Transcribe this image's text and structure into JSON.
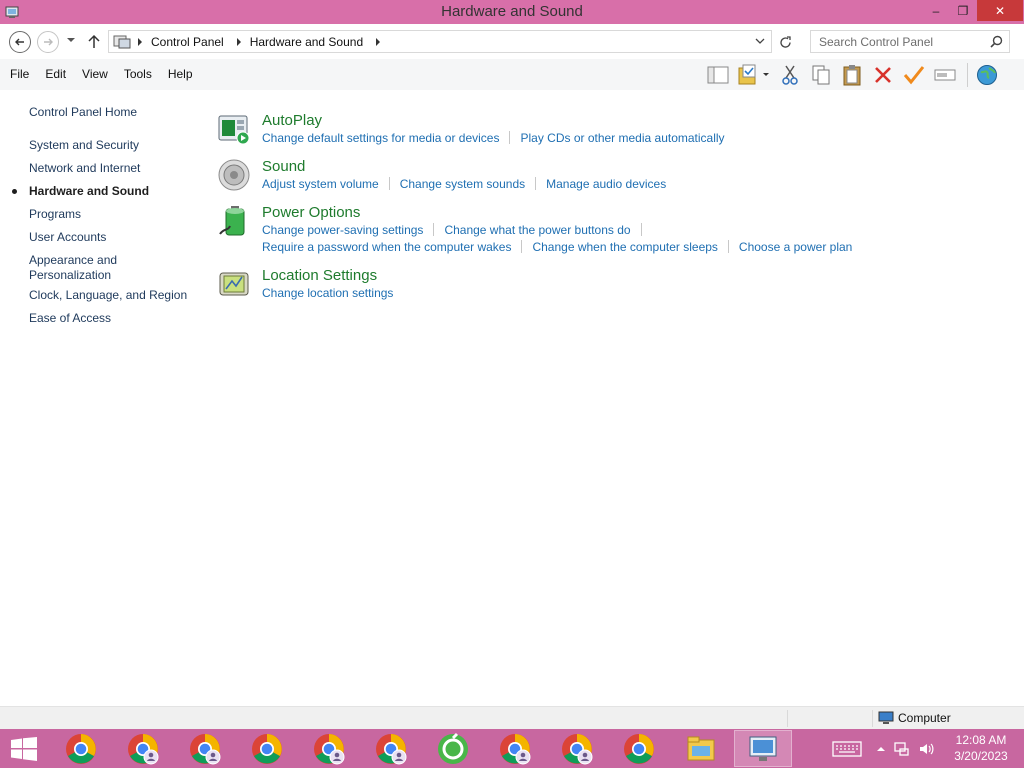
{
  "window": {
    "title": "Hardware and Sound",
    "minimize_glyph": "–",
    "maximize_glyph": "❐",
    "close_glyph": "✕"
  },
  "address": {
    "breadcrumb": [
      "Control Panel",
      "Hardware and Sound"
    ],
    "search_placeholder": "Search Control Panel"
  },
  "menu": {
    "items": [
      "File",
      "Edit",
      "View",
      "Tools",
      "Help"
    ]
  },
  "toolbar": {
    "icons": [
      "layout-pane-icon",
      "folder-check-icon",
      "cut-icon",
      "copy-icon",
      "paste-icon",
      "delete-icon",
      "checkmark-icon",
      "rename-icon",
      "globe-icon"
    ]
  },
  "leftnav": {
    "items": [
      "Control Panel Home",
      "System and Security",
      "Network and Internet",
      "Hardware and Sound",
      "Programs",
      "User Accounts",
      "Appearance and Personalization",
      "Clock, Language, and Region",
      "Ease of Access"
    ],
    "current_index": 3
  },
  "categories": [
    {
      "title": "AutoPlay",
      "icon": "autoplay-icon",
      "link_rows": [
        [
          "Change default settings for media or devices",
          "Play CDs or other media automatically"
        ]
      ]
    },
    {
      "title": "Sound",
      "icon": "speaker-icon",
      "link_rows": [
        [
          "Adjust system volume",
          "Change system sounds",
          "Manage audio devices"
        ]
      ]
    },
    {
      "title": "Power Options",
      "icon": "battery-icon",
      "link_rows": [
        [
          "Change power-saving settings",
          "Change what the power buttons do"
        ],
        [
          "Require a password when the computer wakes",
          "Change when the computer sleeps",
          "Choose a power plan"
        ]
      ]
    },
    {
      "title": "Location Settings",
      "icon": "location-gps-icon",
      "link_rows": [
        [
          "Change location settings"
        ]
      ]
    }
  ],
  "statusbar": {
    "location": "Computer"
  },
  "taskbar": {
    "apps": [
      "chrome-icon",
      "chrome-profile-icon",
      "chrome-profile-icon",
      "chrome-icon",
      "chrome-profile-icon",
      "chrome-profile-icon",
      "coccoc-browser-icon",
      "chrome-profile-icon",
      "chrome-profile-icon",
      "chrome-icon",
      "file-explorer-icon",
      "control-panel-icon"
    ],
    "active_index": 11,
    "clock_time": "12:08 AM",
    "clock_date": "3/20/2023"
  },
  "colors": {
    "titlebar": "#d86fa9",
    "taskbar": "#c867a0",
    "link": "#1f6fb2",
    "category_title": "#1e7b2d",
    "close_button": "#c7393a"
  }
}
